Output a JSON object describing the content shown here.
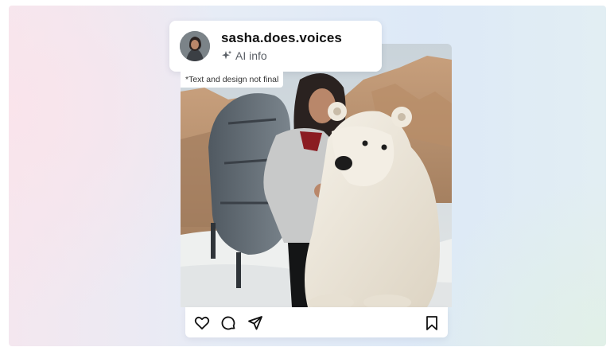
{
  "post": {
    "username": "sasha.does.voices",
    "ai_label": "AI info",
    "disclaimer": "*Text and design not final",
    "image_description_icon": "photo-woman-with-backpack-and-polar-bear"
  },
  "actions": {
    "icons": [
      "heart-icon",
      "comment-icon",
      "share-icon",
      "bookmark-icon"
    ]
  },
  "colors": {
    "card": "#ffffff",
    "text_primary": "#111111",
    "text_secondary": "#5a5f66"
  }
}
